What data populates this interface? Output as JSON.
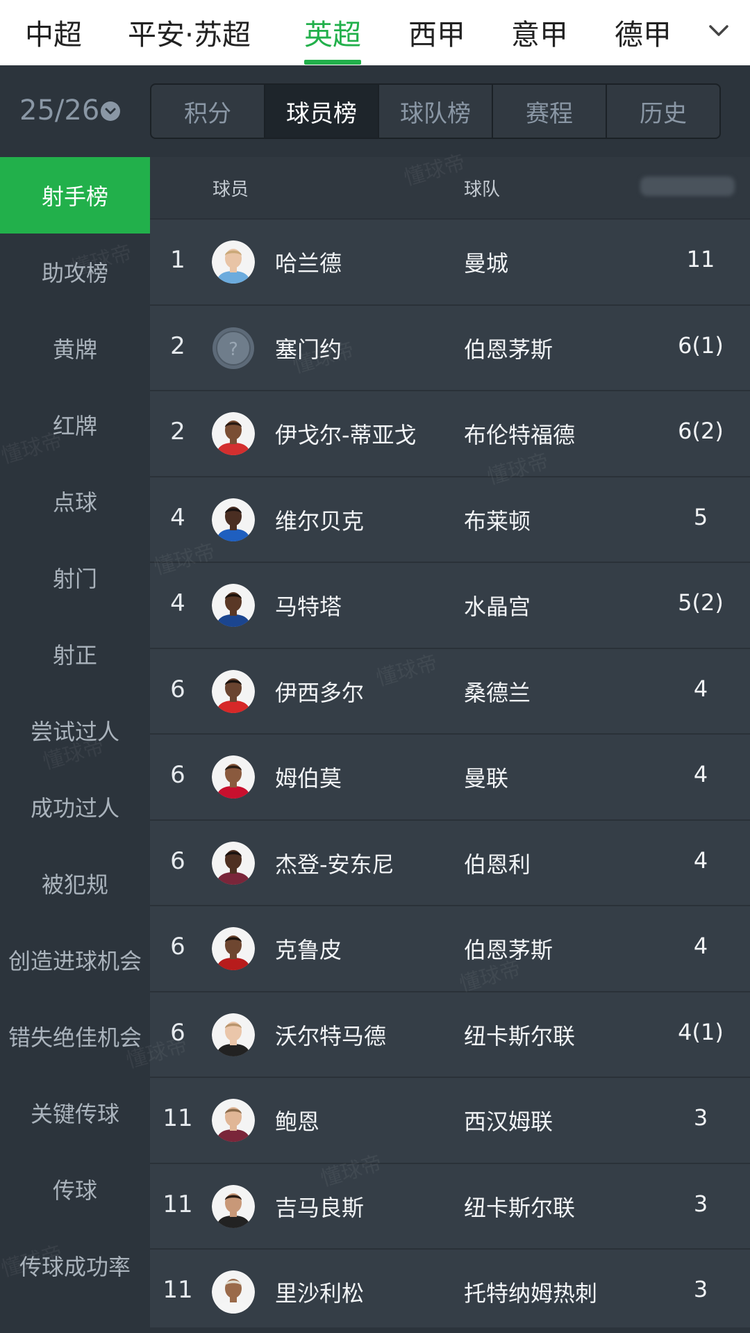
{
  "league_tabs": [
    "中超",
    "平安·苏超",
    "英超",
    "西甲",
    "意甲",
    "德甲"
  ],
  "season": "25/26",
  "segments": [
    "积分",
    "球员榜",
    "球队榜",
    "赛程",
    "历史"
  ],
  "sidebar": [
    "射手榜",
    "助攻榜",
    "黄牌",
    "红牌",
    "点球",
    "射门",
    "射正",
    "尝试过人",
    "成功过人",
    "被犯规",
    "创造进球机会",
    "错失绝佳机会",
    "关键传球",
    "传球",
    "传球成功率"
  ],
  "table": {
    "headers": {
      "player": "球员",
      "team": "球队"
    },
    "rows": [
      {
        "rank": "1",
        "name": "哈兰德",
        "team": "曼城",
        "goals": "11",
        "skin": "#e8c4a6",
        "hair": "#c9a878",
        "jersey": "#6cabdd"
      },
      {
        "rank": "2",
        "name": "塞门约",
        "team": "伯恩茅斯",
        "goals": "6(1)",
        "unknown": true
      },
      {
        "rank": "2",
        "name": "伊戈尔-蒂亚戈",
        "team": "布伦特福德",
        "goals": "6(2)",
        "skin": "#7a4e34",
        "hair": "#2a1a12",
        "jersey": "#d32f2f"
      },
      {
        "rank": "4",
        "name": "维尔贝克",
        "team": "布莱顿",
        "goals": "5",
        "skin": "#4a2e22",
        "hair": "#1a1210",
        "jersey": "#1f5fbf"
      },
      {
        "rank": "4",
        "name": "马特塔",
        "team": "水晶宫",
        "goals": "5(2)",
        "skin": "#5a3826",
        "hair": "#1c120c",
        "jersey": "#1b458f"
      },
      {
        "rank": "6",
        "name": "伊西多尔",
        "team": "桑德兰",
        "goals": "4",
        "skin": "#6a4430",
        "hair": "#1a120e",
        "jersey": "#d62828"
      },
      {
        "rank": "6",
        "name": "姆伯莫",
        "team": "曼联",
        "goals": "4",
        "skin": "#8a5a3e",
        "hair": "#2a1c14",
        "jersey": "#c8102e"
      },
      {
        "rank": "6",
        "name": "杰登-安东尼",
        "team": "伯恩利",
        "goals": "4",
        "skin": "#4e3022",
        "hair": "#1a1210",
        "jersey": "#7a263a"
      },
      {
        "rank": "6",
        "name": " 克鲁皮",
        "team": "伯恩茅斯",
        "goals": "4",
        "skin": "#6e4630",
        "hair": "#1e140e",
        "jersey": "#b71c1c"
      },
      {
        "rank": "6",
        "name": "沃尔特马德",
        "team": "纽卡斯尔联",
        "goals": "4(1)",
        "skin": "#eac6aa",
        "hair": "#b8946c",
        "jersey": "#222222"
      },
      {
        "rank": "11",
        "name": "鲍恩",
        "team": "西汉姆联",
        "goals": "3",
        "skin": "#e0b696",
        "hair": "#8a6a4a",
        "jersey": "#7a263a"
      },
      {
        "rank": "11",
        "name": "吉马良斯",
        "team": "纽卡斯尔联",
        "goals": "3",
        "skin": "#c89878",
        "hair": "#2a1c14",
        "jersey": "#222222"
      },
      {
        "rank": "11",
        "name": "里沙利松",
        "team": "托特纳姆热刺",
        "goals": "3",
        "skin": "#9a6a4a",
        "hair": "#e0dcd0",
        "jersey": "#f5f5f5"
      }
    ]
  },
  "watermark": "懂球帝",
  "colors": {
    "accent": "#22b04b",
    "bg": "#2c343c",
    "table_bg": "#353e47"
  }
}
